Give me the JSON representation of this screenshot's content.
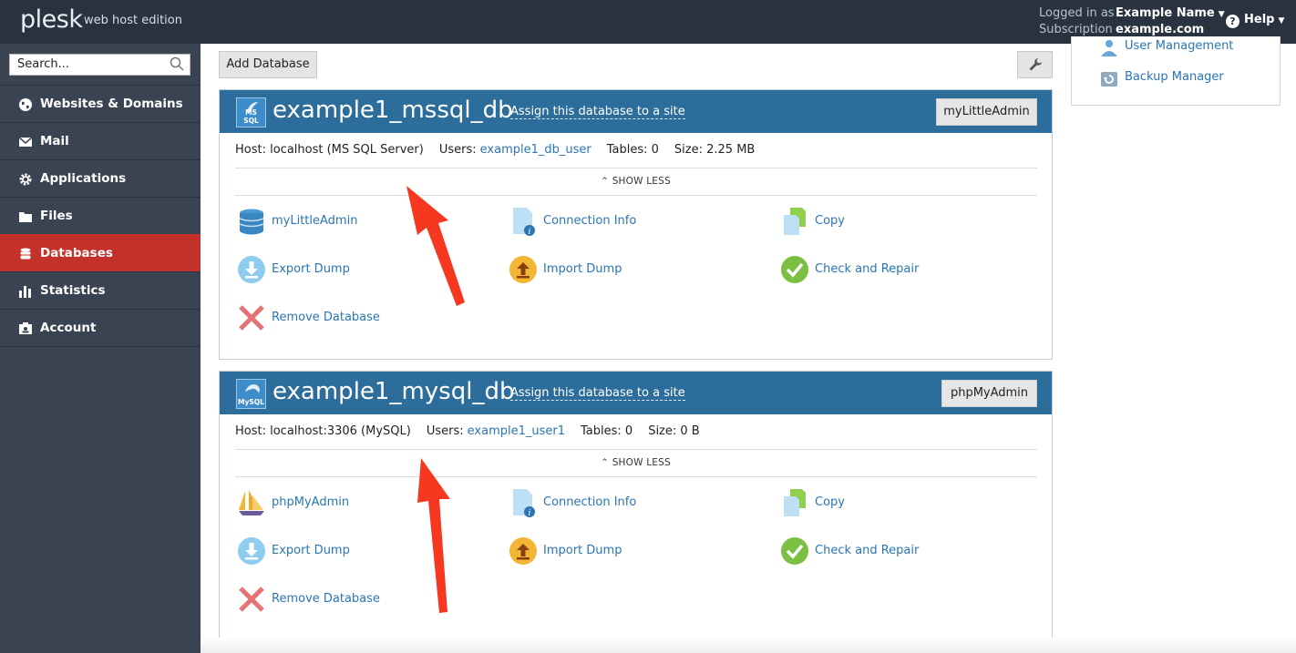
{
  "header": {
    "logo": "plesk",
    "logo_sub": "web host edition",
    "logged_in_label": "Logged in as",
    "logged_in_value": "Example Name",
    "subscription_label": "Subscription",
    "subscription_value": "example.com",
    "help_label": "Help"
  },
  "sidebar": {
    "search_placeholder": "Search...",
    "items": [
      {
        "label": "Websites & Domains",
        "icon": "globe-icon"
      },
      {
        "label": "Mail",
        "icon": "envelope-icon"
      },
      {
        "label": "Applications",
        "icon": "gear-icon"
      },
      {
        "label": "Files",
        "icon": "folder-icon"
      },
      {
        "label": "Databases",
        "icon": "database-icon",
        "active": true
      },
      {
        "label": "Statistics",
        "icon": "bar-chart-icon"
      },
      {
        "label": "Account",
        "icon": "account-card-icon"
      }
    ]
  },
  "toolbar": {
    "add_database": "Add Database"
  },
  "right_panel": {
    "user_management": "User Management",
    "backup_manager": "Backup Manager"
  },
  "databases": [
    {
      "icon_label": "MS SQL",
      "name": "example1_mssql_db",
      "assign": "Assign this database to a site",
      "admin_button": "myLittleAdmin",
      "host": "Host: localhost (MS SQL Server)",
      "users_label": "Users:",
      "users_value": "example1_db_user",
      "tables": "Tables: 0",
      "size": "Size: 2.25 MB",
      "show_less": "SHOW LESS",
      "actions": {
        "admin": "myLittleAdmin",
        "connection_info": "Connection Info",
        "copy": "Copy",
        "export_dump": "Export Dump",
        "import_dump": "Import Dump",
        "check_repair": "Check and Repair",
        "remove": "Remove Database"
      }
    },
    {
      "icon_label": "MySQL",
      "name": "example1_mysql_db",
      "assign": "Assign this database to a site",
      "admin_button": "phpMyAdmin",
      "host": "Host: localhost:3306 (MySQL)",
      "users_label": "Users:",
      "users_value": "example1_user1",
      "tables": "Tables: 0",
      "size": "Size: 0 B",
      "show_less": "SHOW LESS",
      "actions": {
        "admin": "phpMyAdmin",
        "connection_info": "Connection Info",
        "copy": "Copy",
        "export_dump": "Export Dump",
        "import_dump": "Import Dump",
        "check_repair": "Check and Repair",
        "remove": "Remove Database"
      }
    }
  ],
  "colors": {
    "topbar": "#293340",
    "sidebar": "#3a4351",
    "active_nav": "#c4312a",
    "panel_header": "#2d6d9b",
    "link": "#2a75b2",
    "annotation_arrow": "#f5381f"
  }
}
